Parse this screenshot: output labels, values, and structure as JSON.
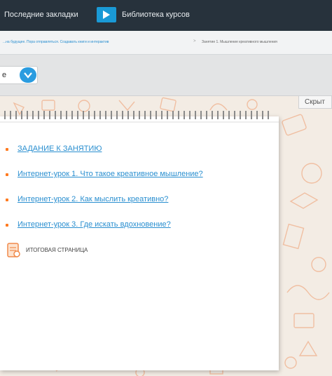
{
  "topbar": {
    "recent_bookmarks": "Последние закладки",
    "icon": "library-video-icon",
    "course_library": "Библиотека курсов"
  },
  "breadcrumb": {
    "trail": "...на будущее. Пора отправляться. Создавать книги и интерактив",
    "separator": ">",
    "current": "Занятие 1. Мышление креативного мышления"
  },
  "toolbar": {
    "select_value": "е",
    "select_icon": "chevron-down-icon"
  },
  "hide_tab": "Скрыт",
  "lessons": [
    {
      "label": "ЗАДАНИЕ К ЗАНЯТИЮ"
    },
    {
      "label": "Интернет-урок 1. Что такое креативное мышление?"
    },
    {
      "label": "Интернет-урок 2. Как мыслить креативно?"
    },
    {
      "label": "Интернет-урок 3. Где искать вдохновение?"
    }
  ],
  "final_page": {
    "icon": "document-icon",
    "label": "ИТОГОВАЯ СТРАНИЦА"
  },
  "colors": {
    "topbar": "#27323c",
    "accent": "#2a9ce0",
    "link": "#2a8fd0",
    "bullet": "#ff7a1f",
    "pattern": "#f0b08c"
  }
}
